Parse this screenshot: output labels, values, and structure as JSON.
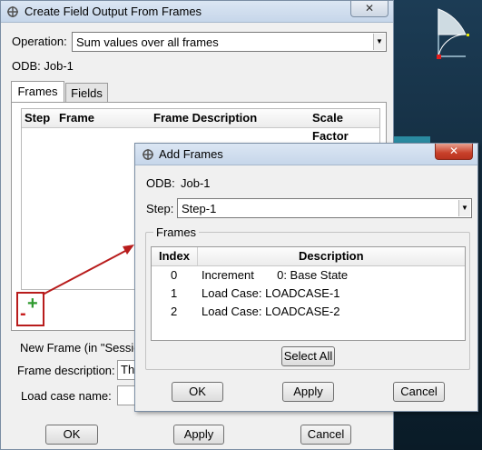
{
  "main_dialog": {
    "title": "Create Field Output From Frames",
    "close_symbol": "✕",
    "operation_label": "Operation:",
    "operation_value": "Sum values over all frames",
    "odb_label": "ODB: Job-1",
    "tabs": [
      {
        "label": "Frames"
      },
      {
        "label": "Fields"
      }
    ],
    "table_headers": {
      "step": "Step",
      "frame": "Frame",
      "description": "Frame Description",
      "scale": "Scale Factor"
    },
    "add_symbol": "+",
    "remove_symbol": "-",
    "new_frame_label": "New Frame (in \"Sessio",
    "frame_description_label": "Frame description:",
    "frame_description_value": "The",
    "load_case_label": "Load case name:",
    "load_case_value": "",
    "ok_label": "OK",
    "apply_label": "Apply",
    "cancel_label": "Cancel"
  },
  "add_frames_dialog": {
    "title": "Add Frames",
    "close_symbol": "✕",
    "odb_label": "ODB:",
    "odb_value": "Job-1",
    "step_label": "Step:",
    "step_value": "Step-1",
    "frames_group_label": "Frames",
    "columns": {
      "index": "Index",
      "description": "Description"
    },
    "rows": [
      {
        "index": "0",
        "description": "Increment       0: Base State"
      },
      {
        "index": "1",
        "description": "Load Case: LOADCASE-1"
      },
      {
        "index": "2",
        "description": "Load Case: LOADCASE-2"
      }
    ],
    "select_all_label": "Select All",
    "ok_label": "OK",
    "apply_label": "Apply",
    "cancel_label": "Cancel"
  },
  "colors": {
    "annotation_red": "#b81c1c",
    "add_green": "#2e9a2e",
    "viewport_blue": "#1c3c55"
  }
}
